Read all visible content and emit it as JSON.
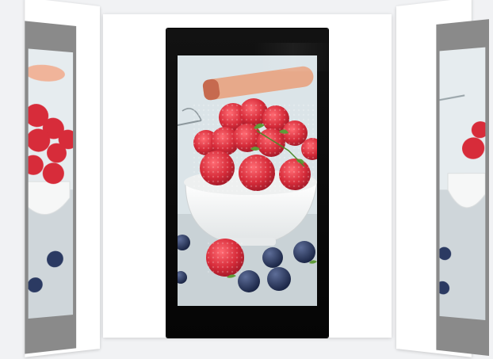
{
  "carousel": {
    "slides": [
      {
        "position": "left",
        "image": "raspberries-bowl-blueberries"
      },
      {
        "position": "center",
        "image": "raspberries-bowl-blueberries"
      },
      {
        "position": "right",
        "image": "raspberries-bowl-blueberries"
      }
    ],
    "active_index": 1
  },
  "colors": {
    "background": "#f1f2f4",
    "card": "#ffffff",
    "device_frame": "#0b0b0b",
    "side_device_frame": "#8a8a8a",
    "raspberry": "#d72c3a",
    "blueberry": "#2b3a62",
    "bowl": "#f7f8f8"
  }
}
